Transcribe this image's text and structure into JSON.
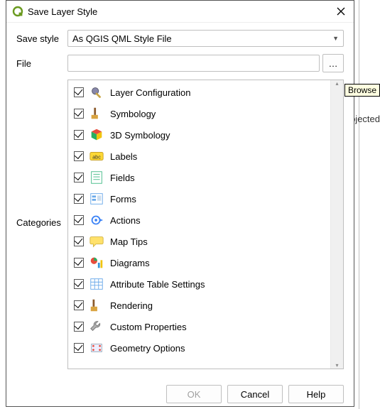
{
  "window": {
    "title": "Save Layer Style",
    "close": "✕"
  },
  "bg": {
    "fragment": "ojected"
  },
  "fields": {
    "save_style_label": "Save style",
    "save_style_value": "As QGIS QML Style File",
    "file_label": "File",
    "file_value": "",
    "browse_label": "…",
    "categories_label": "Categories"
  },
  "categories": [
    {
      "label": "Layer Configuration",
      "checked": true,
      "icon": "gear-wrench"
    },
    {
      "label": "Symbology",
      "checked": true,
      "icon": "brush"
    },
    {
      "label": "3D Symbology",
      "checked": true,
      "icon": "cube3d"
    },
    {
      "label": "Labels",
      "checked": true,
      "icon": "abc"
    },
    {
      "label": "Fields",
      "checked": true,
      "icon": "list-lines"
    },
    {
      "label": "Forms",
      "checked": true,
      "icon": "form"
    },
    {
      "label": "Actions",
      "checked": true,
      "icon": "gear-play"
    },
    {
      "label": "Map Tips",
      "checked": true,
      "icon": "speech"
    },
    {
      "label": "Diagrams",
      "checked": true,
      "icon": "pie-bar"
    },
    {
      "label": "Attribute Table Settings",
      "checked": true,
      "icon": "table"
    },
    {
      "label": "Rendering",
      "checked": true,
      "icon": "paint-brush"
    },
    {
      "label": "Custom Properties",
      "checked": true,
      "icon": "wrench"
    },
    {
      "label": "Geometry Options",
      "checked": true,
      "icon": "nodes"
    }
  ],
  "buttons": {
    "ok": "OK",
    "cancel": "Cancel",
    "help": "Help"
  },
  "tooltip": "Browse"
}
